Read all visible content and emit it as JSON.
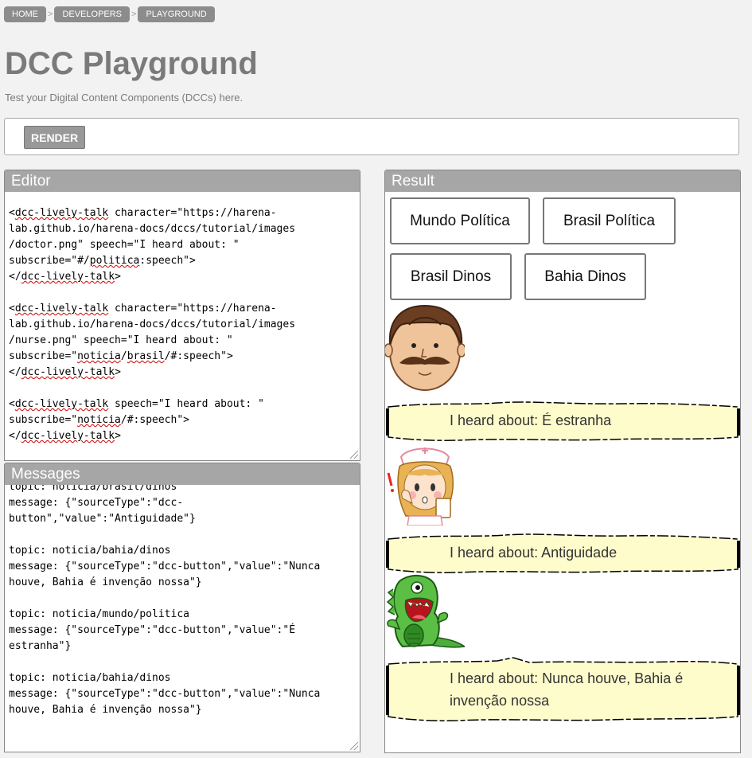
{
  "breadcrumb": [
    "HOME",
    "DEVELOPERS",
    "PLAYGROUND"
  ],
  "breadcrumb_separator": ">",
  "title": "DCC Playground",
  "subtitle": "Test your Digital Content Components (DCCs) here.",
  "render_label": "RENDER",
  "editor": {
    "title": "Editor",
    "lines": [
      [
        {
          "t": "<"
        },
        {
          "t": "dcc-lively-talk",
          "s": 1
        },
        {
          "t": " character=\"https://harena-"
        }
      ],
      [
        {
          "t": "lab.github.io/harena-docs/dccs/tutorial/images"
        }
      ],
      [
        {
          "t": "/doctor.png\" speech=\"I heard about: \""
        }
      ],
      [
        {
          "t": "subscribe=\"#/"
        },
        {
          "t": "politica",
          "s": 1
        },
        {
          "t": ":speech\">"
        }
      ],
      [
        {
          "t": "</"
        },
        {
          "t": "dcc-lively-talk",
          "s": 1
        },
        {
          "t": ">"
        }
      ],
      [
        {
          "t": ""
        }
      ],
      [
        {
          "t": "<"
        },
        {
          "t": "dcc-lively-talk",
          "s": 1
        },
        {
          "t": " character=\"https://harena-"
        }
      ],
      [
        {
          "t": "lab.github.io/harena-docs/dccs/tutorial/images"
        }
      ],
      [
        {
          "t": "/nurse.png\" speech=\"I heard about: \""
        }
      ],
      [
        {
          "t": "subscribe=\""
        },
        {
          "t": "noticia",
          "s": 1
        },
        {
          "t": "/"
        },
        {
          "t": "brasil",
          "s": 1
        },
        {
          "t": "/#:speech\">"
        }
      ],
      [
        {
          "t": "</"
        },
        {
          "t": "dcc-lively-talk",
          "s": 1
        },
        {
          "t": ">"
        }
      ],
      [
        {
          "t": ""
        }
      ],
      [
        {
          "t": "<"
        },
        {
          "t": "dcc-lively-talk",
          "s": 1
        },
        {
          "t": " speech=\"I heard about: \""
        }
      ],
      [
        {
          "t": "subscribe=\""
        },
        {
          "t": "noticia",
          "s": 1
        },
        {
          "t": "/#:speech\">"
        }
      ],
      [
        {
          "t": "</"
        },
        {
          "t": "dcc-lively-talk",
          "s": 1
        },
        {
          "t": ">"
        }
      ]
    ]
  },
  "messages": {
    "title": "Messages",
    "text": "topic: noticia/brasil/dinos\nmessage: {\"sourceType\":\"dcc-\nbutton\",\"value\":\"Antiguidade\"}\n\ntopic: noticia/bahia/dinos\nmessage: {\"sourceType\":\"dcc-button\",\"value\":\"Nunca\nhouve, Bahia é invenção nossa\"}\n\ntopic: noticia/mundo/politica\nmessage: {\"sourceType\":\"dcc-button\",\"value\":\"É\nestranha\"}\n\ntopic: noticia/bahia/dinos\nmessage: {\"sourceType\":\"dcc-button\",\"value\":\"Nunca\nhouve, Bahia é invenção nossa\"}"
  },
  "result": {
    "title": "Result",
    "buttons": [
      "Mundo Política",
      "Brasil Política",
      "Brasil Dinos",
      "Bahia Dinos"
    ],
    "talks": [
      {
        "character": "doctor-icon",
        "speech": "I heard about: É estranha"
      },
      {
        "character": "nurse-icon",
        "speech": "I heard about: Antiguidade"
      },
      {
        "character": "dinosaur-icon",
        "speech": "I heard about: Nunca houve, Bahia é invenção nossa"
      }
    ]
  },
  "colors": {
    "page_bg": "#f2f2f2",
    "header_bg": "#a6a6a6",
    "breadcrumb_bg": "#8c8c8c",
    "bubble_fill": "#fffccc",
    "squiggle": "#d40000"
  }
}
